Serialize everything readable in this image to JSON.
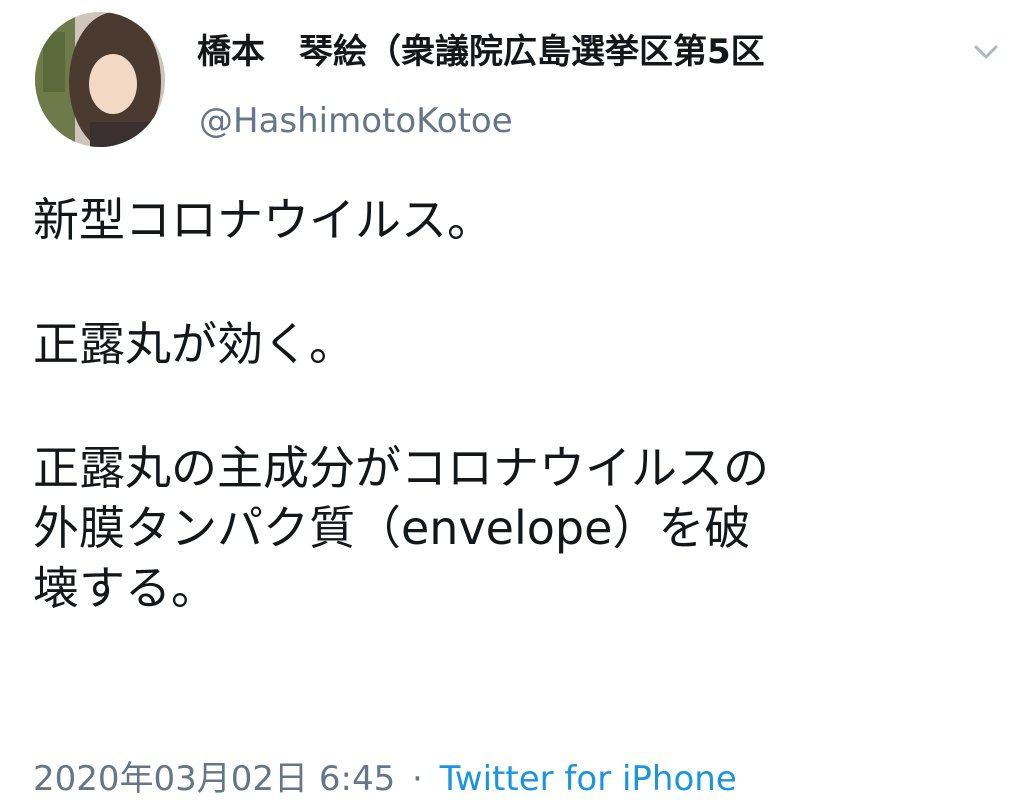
{
  "tweet": {
    "display_name": "橋本　琴絵（衆議院広島選挙区第5区",
    "handle": "@HashimotoKotoe",
    "body": {
      "p1": [
        "新型コロナウイルス。"
      ],
      "p2": [
        "正露丸が効く。"
      ],
      "p3": [
        "正露丸の主成分がコロナウイルスの",
        "外膜タンパク質（envelope）を破",
        "壊する。"
      ]
    },
    "timestamp": "2020年03月02日 6:45",
    "separator": "·",
    "source": "Twitter for iPhone"
  },
  "icons": {
    "avatar": "profile-photo",
    "caret": "chevron-down-icon"
  },
  "colors": {
    "text": "#14171a",
    "secondary": "#657786",
    "link": "#1b95e0",
    "caret": "#aab8c2"
  }
}
